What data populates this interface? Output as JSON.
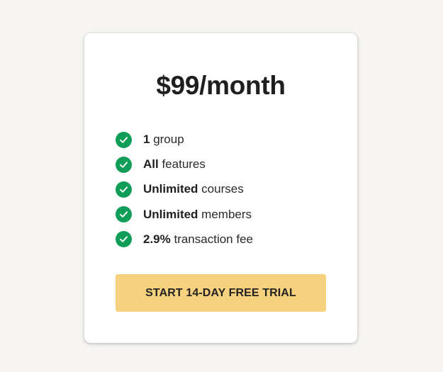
{
  "plan": {
    "price": "$99/month",
    "features": [
      {
        "bold": "1",
        "text": " group"
      },
      {
        "bold": "All",
        "text": " features"
      },
      {
        "bold": "Unlimited",
        "text": " courses"
      },
      {
        "bold": "Unlimited",
        "text": " members"
      },
      {
        "bold": "2.9%",
        "text": " transaction fee"
      }
    ],
    "cta_label": "START 14-DAY FREE TRIAL"
  },
  "colors": {
    "page_background": "#f6f5f3",
    "card_background": "#ffffff",
    "check_green": "#0f9d58",
    "cta_background": "#f7d27e",
    "text_dark": "#1f1f1f"
  },
  "icons": {
    "feature_check": "check-circle-icon"
  }
}
